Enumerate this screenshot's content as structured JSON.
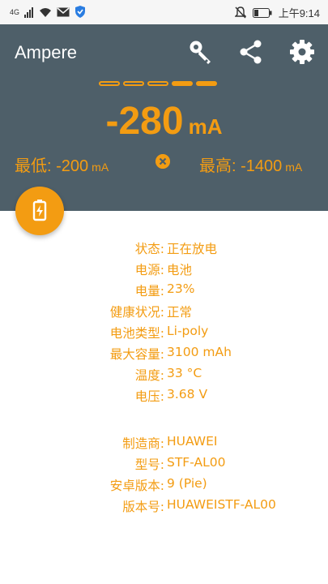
{
  "status_bar": {
    "network": "4G",
    "time": "上午9:14"
  },
  "app": {
    "title": "Ampere",
    "actions": [
      {
        "icon": "key-icon"
      },
      {
        "icon": "share-icon"
      },
      {
        "icon": "gear-icon"
      }
    ]
  },
  "meter": {
    "level_segments_total": 5,
    "level_segments_filled": 2,
    "current_value": "-280",
    "current_unit": "mA",
    "min_label": "最低: -200",
    "min_unit": "mA",
    "max_label": "最高: -1400",
    "max_unit": "mA"
  },
  "colors": {
    "accent": "#f39c12",
    "header_bg": "#4e5f69"
  },
  "battery_info": [
    {
      "key": "状态:",
      "value": "正在放电"
    },
    {
      "key": "电源:",
      "value": "电池"
    },
    {
      "key": "电量:",
      "value": "23%"
    },
    {
      "key": "健康状况:",
      "value": "正常"
    },
    {
      "key": "电池类型:",
      "value": "Li-poly"
    },
    {
      "key": "最大容量:",
      "value": "3100 mAh"
    },
    {
      "key": "温度:",
      "value": "33 °C"
    },
    {
      "key": "电压:",
      "value": "3.68 V"
    }
  ],
  "device_info": [
    {
      "key": "制造商:",
      "value": "HUAWEI"
    },
    {
      "key": "型号:",
      "value": "STF-AL00"
    },
    {
      "key": "安卓版本:",
      "value": "9 (Pie)"
    },
    {
      "key": "版本号:",
      "value": "HUAWEISTF-AL00"
    }
  ]
}
